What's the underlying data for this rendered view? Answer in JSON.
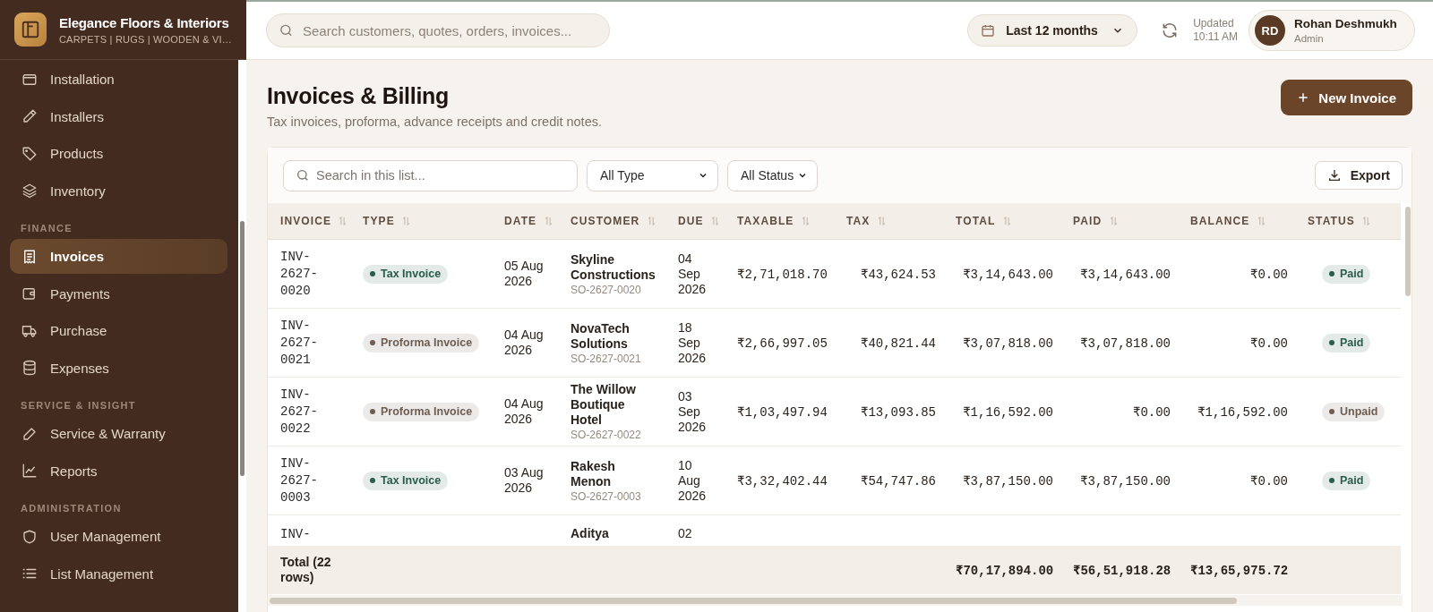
{
  "brand": {
    "name": "Elegance Floors & Interiors",
    "tagline": "CARPETS | RUGS | WOODEN & VI…"
  },
  "sidebar": {
    "items": [
      {
        "kind": "item",
        "label": "Installation",
        "selected": false
      },
      {
        "kind": "item",
        "label": "Installers",
        "selected": false
      },
      {
        "kind": "item",
        "label": "Products",
        "selected": false
      },
      {
        "kind": "item",
        "label": "Inventory",
        "selected": false
      },
      {
        "kind": "section",
        "label": "FINANCE"
      },
      {
        "kind": "item",
        "label": "Invoices",
        "selected": true
      },
      {
        "kind": "item",
        "label": "Payments",
        "selected": false
      },
      {
        "kind": "item",
        "label": "Purchase",
        "selected": false
      },
      {
        "kind": "item",
        "label": "Expenses",
        "selected": false
      },
      {
        "kind": "section",
        "label": "SERVICE & INSIGHT"
      },
      {
        "kind": "item",
        "label": "Service & Warranty",
        "selected": false
      },
      {
        "kind": "item",
        "label": "Reports",
        "selected": false
      },
      {
        "kind": "section",
        "label": "ADMINISTRATION"
      },
      {
        "kind": "item",
        "label": "User Management",
        "selected": false
      },
      {
        "kind": "item",
        "label": "List Management",
        "selected": false
      }
    ]
  },
  "topbar": {
    "search": {
      "placeholder": "Search customers, quotes, orders, invoices..."
    },
    "period": "Last 12 months",
    "updated_label": "Updated",
    "updated_time": "10:11 AM",
    "user": {
      "initials": "RD",
      "name": "Rohan Deshmukh",
      "role": "Admin"
    }
  },
  "page": {
    "title": "Invoices & Billing",
    "subtitle": "Tax invoices, proforma, advance receipts and credit notes.",
    "new_button": "New Invoice"
  },
  "toolbar": {
    "search": {
      "placeholder": "Search in this list..."
    },
    "type_filter": "All Type",
    "status_filter": "All Status",
    "export_button": "Export"
  },
  "table": {
    "columns": [
      {
        "label": "INVOICE"
      },
      {
        "label": "TYPE"
      },
      {
        "label": "DATE"
      },
      {
        "label": "CUSTOMER"
      },
      {
        "label": "DUE"
      },
      {
        "label": "TAXABLE"
      },
      {
        "label": "TAX"
      },
      {
        "label": "TOTAL"
      },
      {
        "label": "PAID"
      },
      {
        "label": "BALANCE"
      },
      {
        "label": "STATUS"
      }
    ],
    "rows": [
      {
        "invoice": "INV-2627-0020",
        "type": {
          "label": "Tax Invoice",
          "color": "#2a5d4c"
        },
        "date": "05 Aug 2026",
        "customer": "Skyline Constructions",
        "order": "SO-2627-0020",
        "due": "04 Sep 2026",
        "taxable": "₹2,71,018.70",
        "tax": "₹43,624.53",
        "total": "₹3,14,643.00",
        "paid": "₹3,14,643.00",
        "balance": "₹0.00",
        "status": {
          "label": "Paid",
          "color": "#2a5d4c"
        }
      },
      {
        "invoice": "INV-2627-0021",
        "type": {
          "label": "Proforma Invoice",
          "color": "#6e5d50"
        },
        "date": "04 Aug 2026",
        "customer": "NovaTech Solutions",
        "order": "SO-2627-0021",
        "due": "18 Sep 2026",
        "taxable": "₹2,66,997.05",
        "tax": "₹40,821.44",
        "total": "₹3,07,818.00",
        "paid": "₹3,07,818.00",
        "balance": "₹0.00",
        "status": {
          "label": "Paid",
          "color": "#2a5d4c"
        }
      },
      {
        "invoice": "INV-2627-0022",
        "type": {
          "label": "Proforma Invoice",
          "color": "#6e5d50"
        },
        "date": "04 Aug 2026",
        "customer": "The Willow Boutique Hotel",
        "order": "SO-2627-0022",
        "due": "03 Sep 2026",
        "taxable": "₹1,03,497.94",
        "tax": "₹13,093.85",
        "total": "₹1,16,592.00",
        "paid": "₹0.00",
        "balance": "₹1,16,592.00",
        "status": {
          "label": "Unpaid",
          "color": "#6e5d50"
        }
      },
      {
        "invoice": "INV-2627-0003",
        "type": {
          "label": "Tax Invoice",
          "color": "#2a5d4c"
        },
        "date": "03 Aug 2026",
        "customer": "Rakesh Menon",
        "order": "SO-2627-0003",
        "due": "10 Aug 2026",
        "taxable": "₹3,32,402.44",
        "tax": "₹54,747.86",
        "total": "₹3,87,150.00",
        "paid": "₹3,87,150.00",
        "balance": "₹0.00",
        "status": {
          "label": "Paid",
          "color": "#2a5d4c"
        }
      },
      {
        "invoice": "INV-",
        "customer": "Aditya",
        "due": "02"
      }
    ],
    "footer": {
      "label": "Total (22 rows)",
      "total": "₹70,17,894.00",
      "paid": "₹56,51,918.28",
      "balance": "₹13,65,975.72"
    }
  }
}
